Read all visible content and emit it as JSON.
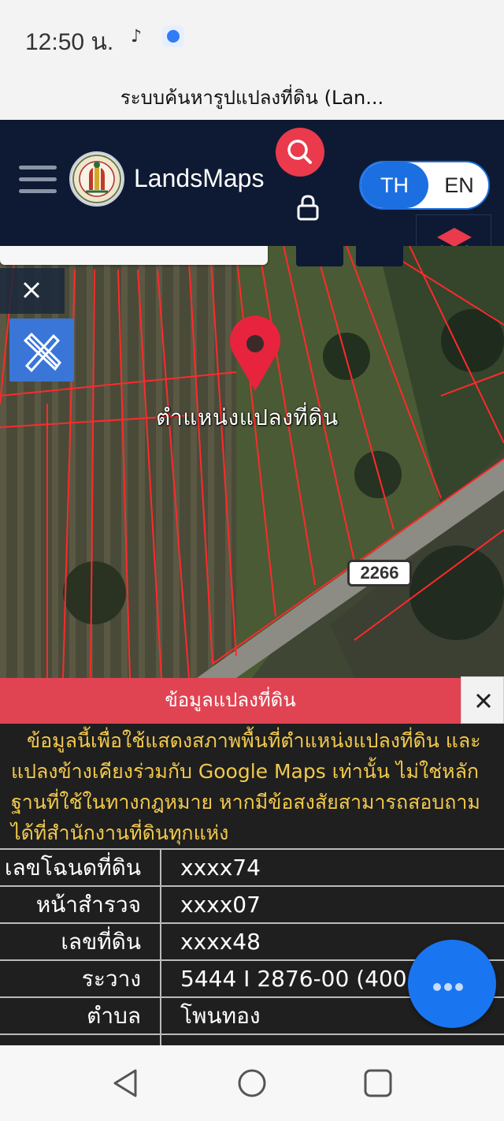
{
  "status_bar": {
    "time": "12:50 น.",
    "tiktok_icon": "♪"
  },
  "title_bar": {
    "title": "ระบบค้นหารูปแปลงที่ดิน (Lan..."
  },
  "header": {
    "brand": "LandsMaps",
    "lang_th": "TH",
    "lang_en": "EN",
    "active_lang": "TH",
    "accent": "#1c6fe0",
    "search_color": "#ea3a4b"
  },
  "map": {
    "pin_label": "ตำแหน่งแปลงที่ดิน",
    "route_number": "2266"
  },
  "info_panel": {
    "title": "ข้อมูลแปลงที่ดิน",
    "disclaimer": "ข้อมูลนี้เพื่อใช้แสดงสภาพพื้นที่ตำแหน่งแปลงที่ดิน และแปลงข้างเคียงร่วมกับ Google Maps เท่านั้น ไม่ใช่หลักฐานที่ใช้ในทางกฎหมาย หากมีข้อสงสัยสามารถสอบถามได้ที่สำนักงานที่ดินทุกแห่ง",
    "rows": [
      {
        "label": "เลขโฉนดที่ดิน",
        "value": "xxxx74"
      },
      {
        "label": "หน้าสำรวจ",
        "value": "xxxx07"
      },
      {
        "label": "เลขที่ดิน",
        "value": "xxxx48"
      },
      {
        "label": "ระวาง",
        "value": "5444 I 2876-00 (400"
      },
      {
        "label": "ตำบล",
        "value": "โพนทอง"
      }
    ],
    "header_color": "#e04453",
    "disclaimer_color": "#f2c94c"
  },
  "icons": {
    "menu": "hamburger-icon",
    "search": "search-icon",
    "lock": "lock-icon",
    "layers": "layers-icon",
    "close": "close-icon",
    "draw": "ruler-pencil-icon",
    "pin": "map-pin-icon",
    "more": "more-dots-icon"
  }
}
